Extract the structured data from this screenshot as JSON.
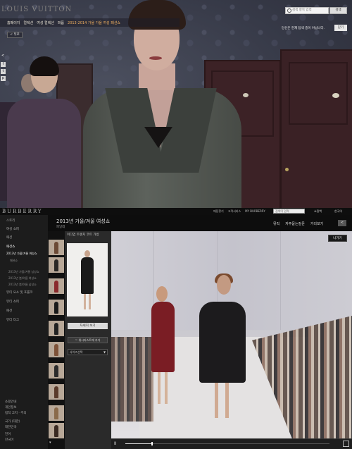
{
  "louis_vuitton": {
    "logo": "LOUIS VUITTON",
    "nav": [
      "홈페이지",
      "컬렉션",
      "여성 컬렉션",
      "퍼퓸",
      "2013-2014 가을 가을 여성 패션쇼"
    ],
    "back": "< 뒤로",
    "search_placeholder": "검색 항목 입력",
    "search_button": "검색",
    "notice": "당신은 현재 탐색 중이 아닙니다.",
    "close": "닫기",
    "share": "<",
    "social": [
      "f",
      "t",
      "p"
    ]
  },
  "burberry": {
    "logo": "BURBERRY",
    "top_links": [
      "매장찾기",
      "고객서비스",
      "MY BURBERRY"
    ],
    "search_placeholder": "검색어 입력",
    "bag": "쇼핑백",
    "site": "한국어",
    "sidebar": {
      "items": [
        {
          "label": "스토리"
        },
        {
          "label": "여성 쇼퍼"
        },
        {
          "label": "패션"
        },
        {
          "label": "패션쇼"
        },
        {
          "label": "2013년 가을/겨울 여성쇼"
        },
        {
          "label": "패션쇼"
        },
        {
          "label": "2013년 가을/겨울 남성쇼"
        },
        {
          "label": "2013년 봄/여름 여성쇼"
        },
        {
          "label": "2013년 봄/여름 남성쇼"
        },
        {
          "label": "뷰티 요소 및 포롤코"
        },
        {
          "label": "뷰티 쇼퍼"
        },
        {
          "label": "패션"
        },
        {
          "label": "뷰티 타그"
        }
      ],
      "footer": [
        "쇼핑안내",
        "개인정보",
        "법적 고지 · 주의",
        "국가 (대한)",
        "대한민국",
        "언어",
        "한국어"
      ]
    },
    "title": "2013년 가을/겨울 여성쇼",
    "subtitle": "피날레",
    "tabs": [
      "뮤직",
      "자주묻는질문",
      "거리보기"
    ],
    "share": "<",
    "product": {
      "label": "미디엄 트렌치 코트 가방",
      "detail_button": "자세히 보기",
      "wish_button": "♡ 위시리스트에 추가",
      "size_select": "사이즈선택"
    },
    "video": {
      "exit": "나가기",
      "pause": "II",
      "progress": 0.13
    }
  },
  "colors": {
    "accent": "#f0b060"
  }
}
